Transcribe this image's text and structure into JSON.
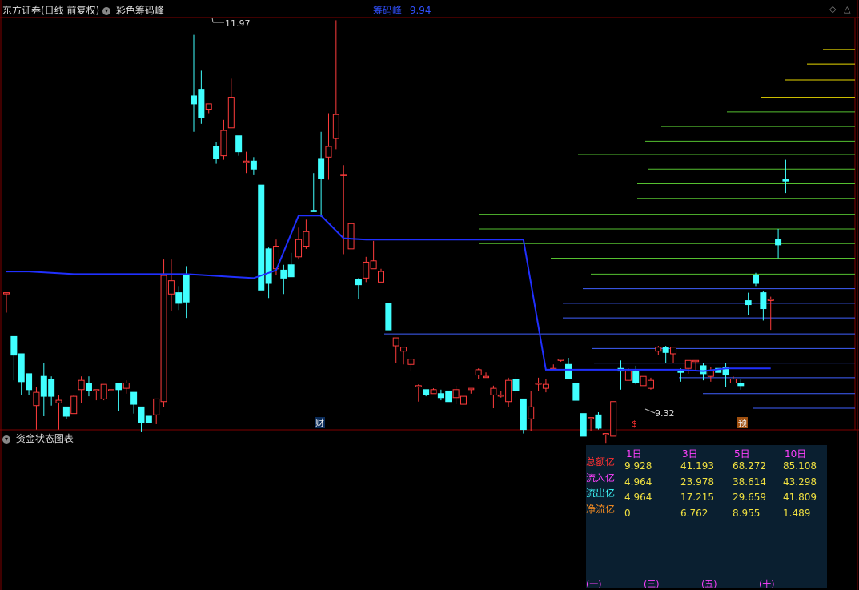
{
  "header": {
    "title": "东方证券(日线 前复权)",
    "indicator": "彩色筹码峰",
    "peak_label": "筹码峰",
    "peak_value": "9.94"
  },
  "markers": {
    "high_label": "11.97",
    "low_label": "9.32",
    "cai": "财",
    "dollar": "$",
    "yu": "预"
  },
  "lower_panel": {
    "title": "资金状态图表"
  },
  "fund_table": {
    "columns": [
      "1日",
      "3日",
      "5日",
      "10日"
    ],
    "rows": [
      {
        "label": "总额亿",
        "color": "#ff3030",
        "values": [
          "9.928",
          "41.193",
          "68.272",
          "85.108"
        ]
      },
      {
        "label": "流入亿",
        "color": "#ff40ff",
        "values": [
          "4.964",
          "23.978",
          "38.614",
          "43.298"
        ]
      },
      {
        "label": "流出亿",
        "color": "#40ffff",
        "values": [
          "4.964",
          "17.215",
          "29.659",
          "41.809"
        ]
      },
      {
        "label": "净流亿",
        "color": "#ff9020",
        "values": [
          "0",
          "6.762",
          "8.955",
          "1.489"
        ]
      }
    ],
    "groups": [
      "(一)",
      "(三)",
      "(五)",
      "(十)"
    ]
  },
  "chart_data": {
    "type": "candlestick",
    "title": "东方证券(日线 前复权)",
    "y_high": 11.97,
    "y_low": 9.32,
    "ylim": [
      9.1,
      12.1
    ],
    "peak_price": 9.94,
    "candles": [
      [
        10.03,
        10.03,
        9.98,
        9.88
      ],
      [
        9.7,
        9.56,
        9.52,
        9.37
      ],
      [
        9.57,
        9.36,
        9.39,
        9.26
      ],
      [
        9.42,
        9.3,
        9.33,
        9.26
      ],
      [
        9.18,
        9.28,
        9.32,
        9.0
      ],
      [
        9.4,
        9.25,
        9.5,
        9.1
      ],
      [
        9.38,
        9.25,
        9.4,
        9.18
      ],
      [
        9.2,
        9.22,
        9.26,
        9.0
      ],
      [
        9.17,
        9.1,
        9.08,
        9.08
      ],
      [
        9.12,
        9.25,
        9.26,
        9.2
      ],
      [
        9.3,
        9.37,
        9.4,
        9.2
      ],
      [
        9.35,
        9.29,
        9.4,
        9.25
      ],
      [
        9.3,
        9.3,
        9.25,
        9.22
      ],
      [
        9.23,
        9.34,
        9.34,
        9.22
      ],
      [
        9.3,
        9.3,
        9.27,
        9.3
      ],
      [
        9.35,
        9.3,
        9.35,
        9.14
      ],
      [
        9.31,
        9.35,
        9.37,
        9.27
      ],
      [
        9.28,
        9.19,
        9.2,
        9.12
      ],
      [
        9.17,
        9.05,
        9.07,
        8.98
      ],
      [
        9.1,
        9.05,
        9.06,
        9.05
      ],
      [
        9.11,
        9.23,
        9.23,
        9.04
      ],
      [
        9.21,
        10.16,
        10.28,
        9.17
      ],
      [
        10.02,
        10.12,
        10.28,
        9.89
      ],
      [
        10.03,
        9.95,
        10.08,
        9.9
      ],
      [
        10.17,
        9.96,
        10.23,
        9.84
      ],
      [
        11.51,
        11.45,
        11.97,
        11.24
      ],
      [
        11.56,
        11.35,
        11.7,
        11.3
      ],
      [
        11.41,
        11.45,
        11.45,
        11.38
      ],
      [
        11.13,
        11.04,
        11.16,
        11.0
      ],
      [
        11.06,
        11.25,
        11.33,
        11.03
      ],
      [
        11.27,
        11.5,
        11.64,
        11.27
      ],
      [
        11.21,
        11.09,
        11.17,
        11.06
      ],
      [
        11.01,
        11.02,
        11.09,
        10.93
      ],
      [
        11.02,
        10.96,
        11.05,
        10.92
      ],
      [
        10.84,
        10.05,
        10.09,
        10.43
      ],
      [
        10.36,
        10.1,
        10.37,
        9.99
      ],
      [
        10.21,
        10.38,
        10.43,
        10.16
      ],
      [
        10.2,
        10.14,
        10.24,
        10.02
      ],
      [
        10.24,
        10.15,
        10.33,
        10.17
      ],
      [
        10.3,
        10.43,
        10.52,
        10.28
      ],
      [
        10.38,
        10.49,
        10.58,
        10.36
      ],
      [
        10.65,
        10.64,
        10.93,
        10.68
      ],
      [
        11.04,
        10.89,
        11.24,
        10.6
      ],
      [
        11.05,
        11.13,
        11.38,
        10.88
      ],
      [
        11.19,
        11.37,
        12.08,
        11.11
      ],
      [
        10.92,
        10.92,
        10.99,
        10.32
      ],
      [
        10.36,
        10.55,
        10.51,
        10.44
      ],
      [
        10.13,
        10.09,
        10.14,
        9.98
      ],
      [
        10.14,
        10.26,
        10.3,
        10.11
      ],
      [
        10.21,
        10.27,
        10.42,
        10.24
      ],
      [
        10.11,
        10.19,
        10.21,
        10.25
      ],
      [
        9.95,
        9.75,
        9.91,
        9.79
      ],
      [
        9.63,
        9.69,
        9.65,
        9.5
      ],
      [
        9.59,
        9.62,
        9.6,
        9.49
      ],
      [
        9.49,
        9.53,
        9.51,
        9.44
      ],
      [
        9.32,
        9.33,
        9.34,
        9.21
      ],
      [
        9.3,
        9.26,
        9.23,
        9.25
      ],
      [
        9.27,
        9.3,
        9.31,
        9.28
      ],
      [
        9.27,
        9.24,
        9.3,
        9.22
      ],
      [
        9.29,
        9.21,
        9.28,
        9.21
      ],
      [
        9.24,
        9.3,
        9.33,
        9.19
      ],
      [
        9.19,
        9.25,
        9.25,
        9.21
      ],
      [
        9.3,
        9.31,
        9.3,
        9.27
      ],
      [
        9.41,
        9.45,
        9.46,
        9.38
      ],
      [
        9.4,
        9.4,
        9.43,
        9.39
      ],
      [
        9.26,
        9.31,
        9.33,
        9.16
      ],
      [
        9.26,
        9.26,
        9.29,
        9.24
      ],
      [
        9.21,
        9.37,
        9.39,
        9.17
      ],
      [
        9.38,
        9.29,
        9.43,
        9.24
      ],
      [
        9.23,
        9.0,
        9.03,
        8.97
      ],
      [
        9.08,
        9.17,
        9.29,
        8.99
      ],
      [
        9.35,
        9.35,
        9.39,
        9.29
      ],
      [
        9.31,
        9.34,
        9.38,
        9.28
      ],
      [
        9.46,
        9.46,
        9.49,
        9.46
      ],
      [
        9.52,
        9.53,
        9.53,
        9.51
      ],
      [
        9.49,
        9.38,
        9.54,
        9.4
      ],
      [
        9.35,
        9.22,
        9.18,
        9.22
      ],
      [
        9.12,
        8.95,
        8.94,
        8.97
      ],
      [
        9.09,
        9.09,
        9.08,
        8.99
      ],
      [
        9.11,
        9.01,
        9.13,
        9.0
      ],
      [
        8.96,
        8.97,
        8.93,
        8.9
      ],
      [
        8.95,
        9.21,
        9.2,
        8.98
      ],
      [
        9.46,
        9.44,
        9.52,
        9.3
      ],
      [
        9.37,
        9.44,
        9.46,
        9.38
      ],
      [
        9.44,
        9.35,
        9.48,
        9.34
      ],
      [
        9.33,
        9.4,
        9.38,
        9.33
      ],
      [
        9.31,
        9.37,
        9.39,
        9.3
      ],
      [
        9.59,
        9.62,
        9.63,
        9.56
      ],
      [
        9.62,
        9.58,
        9.63,
        9.5
      ],
      [
        9.57,
        9.62,
        9.62,
        9.5
      ],
      [
        9.44,
        9.43,
        9.46,
        9.36
      ],
      [
        9.46,
        9.52,
        9.51,
        9.42
      ],
      [
        9.52,
        9.52,
        9.5,
        9.44
      ],
      [
        9.48,
        9.42,
        9.5,
        9.37
      ],
      [
        9.4,
        9.44,
        9.47,
        9.36
      ],
      [
        9.46,
        9.43,
        9.44,
        9.43
      ],
      [
        9.47,
        9.41,
        9.5,
        9.32
      ],
      [
        9.35,
        9.38,
        9.4,
        9.39
      ],
      [
        9.35,
        9.33,
        9.38,
        9.3
      ],
      [
        9.97,
        9.94,
        10.03,
        9.86
      ],
      [
        10.16,
        10.1,
        10.18,
        10.08
      ],
      [
        10.03,
        9.91,
        10.04,
        9.82
      ],
      [
        9.98,
        9.98,
        10.0,
        9.75
      ],
      [
        10.43,
        10.39,
        10.51,
        10.29
      ],
      [
        10.88,
        10.87,
        11.03,
        10.78
      ]
    ],
    "cost_line": [
      10.19,
      10.19,
      10.18,
      10.17,
      10.17,
      10.17,
      10.17,
      10.17,
      10.17,
      10.16,
      10.15,
      10.14,
      10.2,
      10.61,
      10.61,
      10.44,
      10.43,
      10.43,
      10.43,
      10.43,
      10.43,
      10.43,
      10.43,
      10.43,
      9.45,
      9.45,
      9.45,
      9.45,
      9.45,
      9.45,
      9.45,
      9.44,
      9.46,
      9.46,
      9.46
    ],
    "chip_peaks": [
      {
        "price": 11.86,
        "color": "#e8d800"
      },
      {
        "price": 11.75,
        "color": "#e8d800"
      },
      {
        "price": 11.63,
        "color": "#e8d800"
      },
      {
        "price": 11.5,
        "color": "#e8d800"
      },
      {
        "price": 11.39,
        "color": "#55c030"
      },
      {
        "price": 11.28,
        "color": "#55c030"
      },
      {
        "price": 11.17,
        "color": "#55c030"
      },
      {
        "price": 11.07,
        "color": "#55c030"
      },
      {
        "price": 10.96,
        "color": "#55c030"
      },
      {
        "price": 10.85,
        "color": "#55c030"
      },
      {
        "price": 10.74,
        "color": "#55c030"
      },
      {
        "price": 10.62,
        "color": "#55c030"
      },
      {
        "price": 10.51,
        "color": "#55c030"
      },
      {
        "price": 10.4,
        "color": "#55c030"
      },
      {
        "price": 10.29,
        "color": "#55c030"
      },
      {
        "price": 10.17,
        "color": "#55c030"
      },
      {
        "price": 10.06,
        "color": "#4060ff"
      },
      {
        "price": 9.95,
        "color": "#4060ff"
      },
      {
        "price": 9.84,
        "color": "#4060ff"
      },
      {
        "price": 9.72,
        "color": "#4060ff"
      },
      {
        "price": 9.61,
        "color": "#4060ff"
      },
      {
        "price": 9.5,
        "color": "#4060ff"
      },
      {
        "price": 9.39,
        "color": "#4060ff"
      },
      {
        "price": 9.27,
        "color": "#4060ff"
      },
      {
        "price": 9.16,
        "color": "#4060ff"
      }
    ],
    "fund_bars": {
      "groups": [
        "(一)",
        "(三)",
        "(五)",
        "(十)"
      ],
      "series": [
        {
          "name": "总额亿",
          "values": [
            9.928,
            41.193,
            68.272,
            85.108
          ],
          "color": "#a01010"
        },
        {
          "name": "流入亿",
          "values": [
            4.964,
            23.978,
            38.614,
            43.298
          ],
          "color": "#ff10ff"
        },
        {
          "name": "流出亿",
          "values": [
            4.964,
            17.215,
            29.659,
            41.809
          ],
          "color": "#10ffff"
        }
      ]
    }
  }
}
